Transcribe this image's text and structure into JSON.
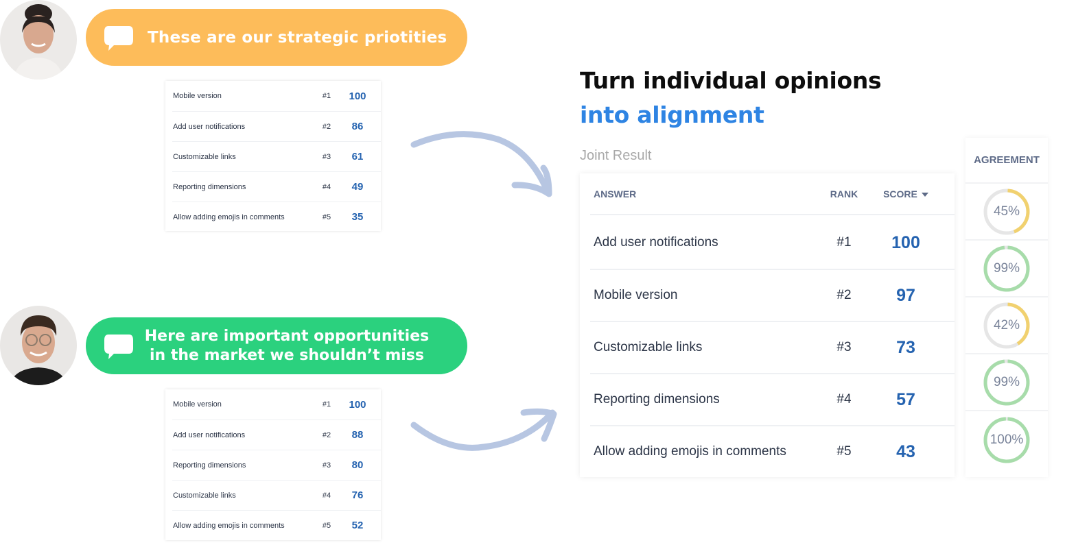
{
  "colors": {
    "bubble_orange": "#fdbc5a",
    "bubble_green": "#2bd17e",
    "accent_blue": "#2e84e3",
    "score_blue": "#2563b0",
    "arrow": "#b7c6e2",
    "donut_yellow": "#f1d16f",
    "donut_green": "#a7dcaa",
    "donut_track": "#e6e6e6"
  },
  "people": [
    {
      "avatar": "woman-avatar",
      "message": "These are our strategic priotities",
      "ranking": [
        {
          "answer": "Mobile version",
          "rank": "#1",
          "score": "100"
        },
        {
          "answer": "Add user notifications",
          "rank": "#2",
          "score": "86"
        },
        {
          "answer": "Customizable links",
          "rank": "#3",
          "score": "61"
        },
        {
          "answer": "Reporting dimensions",
          "rank": "#4",
          "score": "49"
        },
        {
          "answer": "Allow adding emojis in comments",
          "rank": "#5",
          "score": "35"
        }
      ]
    },
    {
      "avatar": "man-avatar",
      "message_line1": "Here are important opportunities",
      "message_line2": "in the market we shouldn’t miss",
      "ranking": [
        {
          "answer": "Mobile version",
          "rank": "#1",
          "score": "100"
        },
        {
          "answer": "Add user notifications",
          "rank": "#2",
          "score": "88"
        },
        {
          "answer": "Reporting dimensions",
          "rank": "#3",
          "score": "80"
        },
        {
          "answer": "Customizable links",
          "rank": "#4",
          "score": "76"
        },
        {
          "answer": "Allow adding emojis in comments",
          "rank": "#5",
          "score": "52"
        }
      ]
    }
  ],
  "headline": {
    "line1": "Turn individual opinions",
    "line2": "into alignment"
  },
  "joint_result": {
    "label": "Joint Result",
    "columns": {
      "answer": "ANSWER",
      "rank": "RANK",
      "score": "SCORE",
      "agreement": "AGREEMENT"
    },
    "sort": "score-descending",
    "rows": [
      {
        "answer": "Add user notifications",
        "rank": "#1",
        "score": "100",
        "agreement": 45,
        "agreement_label": "45%",
        "level": "low"
      },
      {
        "answer": "Mobile version",
        "rank": "#2",
        "score": "97",
        "agreement": 99,
        "agreement_label": "99%",
        "level": "high"
      },
      {
        "answer": "Customizable links",
        "rank": "#3",
        "score": "73",
        "agreement": 42,
        "agreement_label": "42%",
        "level": "low"
      },
      {
        "answer": "Reporting dimensions",
        "rank": "#4",
        "score": "57",
        "agreement": 99,
        "agreement_label": "99%",
        "level": "high"
      },
      {
        "answer": "Allow adding emojis in comments",
        "rank": "#5",
        "score": "43",
        "agreement": 100,
        "agreement_label": "100%",
        "level": "high"
      }
    ]
  }
}
